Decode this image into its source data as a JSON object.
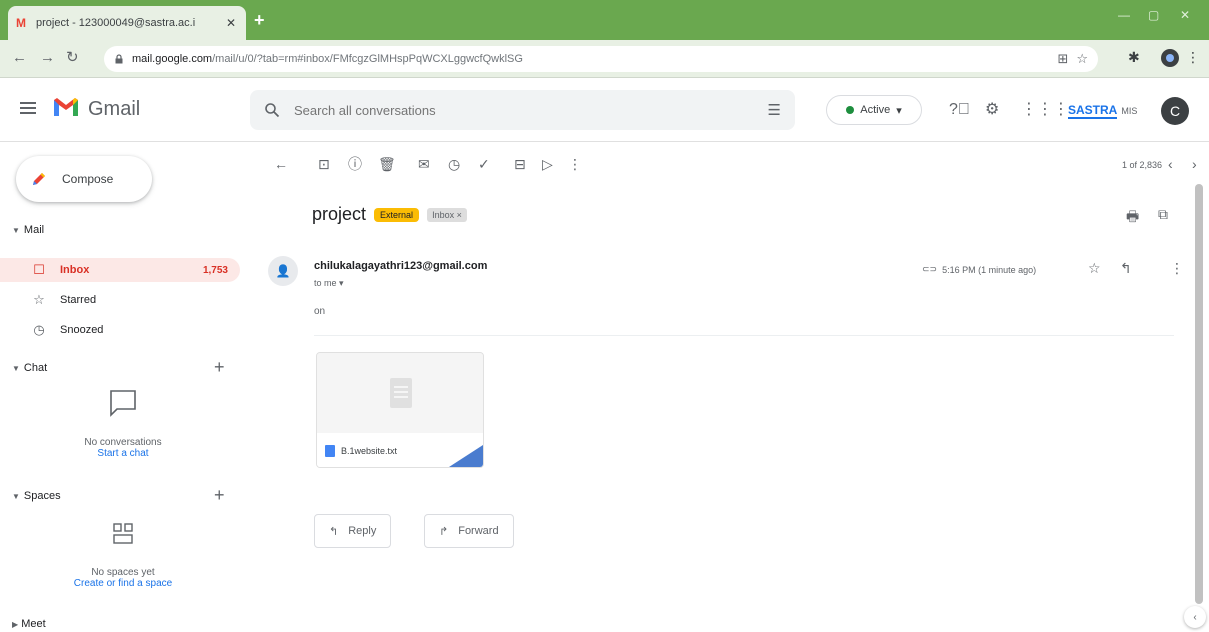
{
  "browser": {
    "tab_title": "project - 123000049@sastra.ac.i",
    "tab_close": "✕",
    "new_tab": "+",
    "url_host": "mail.google.com",
    "url_path": "/mail/u/0/?tab=rm#inbox/FMfcgzGlMHspPqWCXLggwcfQwklSG"
  },
  "header": {
    "app_name": "Gmail",
    "search_placeholder": "Search all conversations",
    "status_label": "Active",
    "status_color": "#1e8e3e",
    "org_mark": "SASTRA",
    "org_text": "MIS",
    "avatar_letter": "C"
  },
  "sidebar": {
    "compose_label": "Compose",
    "mail_header": "Mail",
    "items": [
      {
        "label": "Inbox",
        "count": "1,753",
        "icon": "inbox-icon"
      },
      {
        "label": "Starred",
        "count": "",
        "icon": "star-icon"
      },
      {
        "label": "Snoozed",
        "count": "",
        "icon": "clock-icon"
      }
    ],
    "chat_header": "Chat",
    "chat_empty": "No conversations",
    "chat_link": "Start a chat",
    "spaces_header": "Spaces",
    "spaces_empty": "No spaces yet",
    "spaces_link": "Create or find a space",
    "meet_header": "Meet"
  },
  "message": {
    "pager": "1 of 2,836",
    "subject": "project",
    "label_external": "External",
    "label_inbox": "Inbox ×",
    "sender": "chilukalagayathri123@gmail.com",
    "to": "to me ▾",
    "body": "on",
    "time": "5:16 PM (1 minute ago)",
    "attachment_name": "B.1website.txt",
    "reply_label": "Reply",
    "forward_label": "Forward"
  },
  "colors": {
    "browser_frame": "#6aa84f",
    "inbox_active_bg": "#fce8e6",
    "inbox_active_fg": "#d93025",
    "external_label": "#fbbc04"
  }
}
